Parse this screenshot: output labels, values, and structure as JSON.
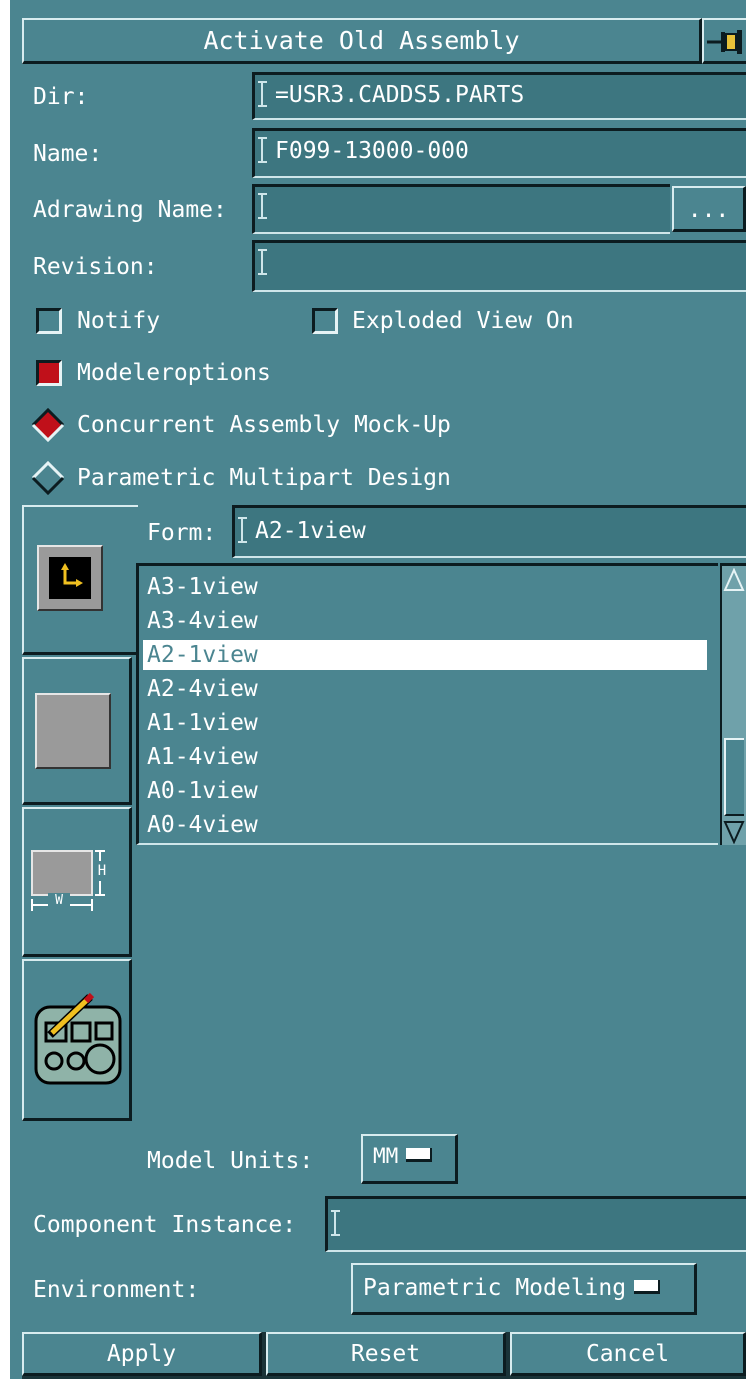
{
  "window": {
    "title": "Activate Old Assembly"
  },
  "fields": {
    "dir": {
      "label": "Dir:",
      "value": "=USR3.CADDS5.PARTS"
    },
    "name": {
      "label": "Name:",
      "value": "F099-13000-000"
    },
    "adrawing": {
      "label": "Adrawing Name:",
      "value": "",
      "browse_label": "..."
    },
    "revision": {
      "label": "Revision:",
      "value": ""
    }
  },
  "checkboxes": {
    "notify": {
      "label": "Notify",
      "checked": false
    },
    "exploded": {
      "label": "Exploded View On",
      "checked": false
    },
    "modeleroptions": {
      "label": "Modeleroptions",
      "checked": true
    }
  },
  "radios": {
    "concurrent": {
      "label": "Concurrent Assembly Mock-Up",
      "selected": true
    },
    "parametric": {
      "label": "Parametric Multipart Design",
      "selected": false
    }
  },
  "form": {
    "label": "Form:",
    "value": "A2-1view",
    "items": [
      "A3-1view",
      "A3-4view",
      "A2-1view",
      "A2-4view",
      "A1-1view",
      "A1-4view",
      "A0-1view",
      "A0-4view"
    ],
    "selected_index": 2
  },
  "tabs": {
    "size_w": "W",
    "size_h": "H"
  },
  "model_units": {
    "label": "Model Units:",
    "value": "MM"
  },
  "component_instance": {
    "label": "Component Instance:",
    "value": ""
  },
  "environment": {
    "label": "Environment:",
    "value": "Parametric Modeling"
  },
  "buttons": {
    "apply": "Apply",
    "reset": "Reset",
    "cancel": "Cancel"
  },
  "colors": {
    "background": "#4b8590",
    "checked": "#c0101a",
    "selection": "#ffffff"
  }
}
